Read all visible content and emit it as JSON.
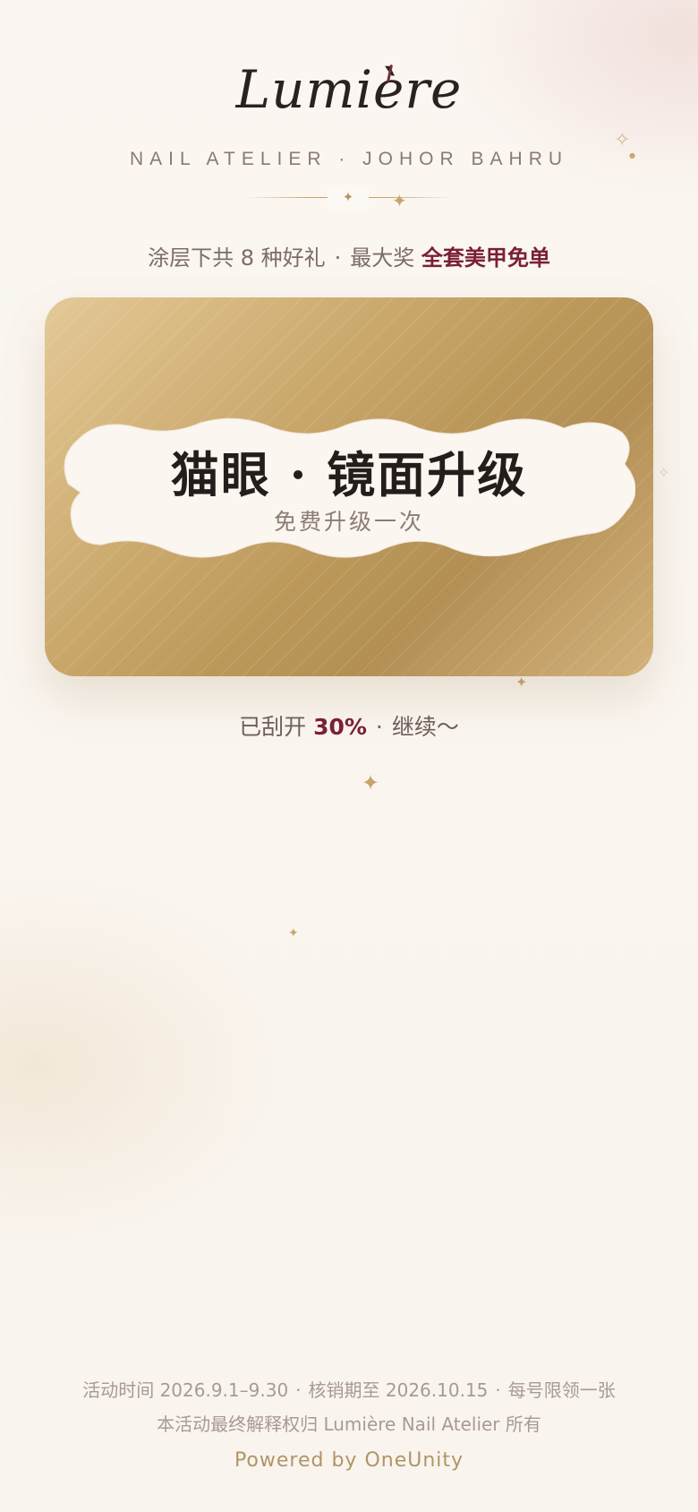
{
  "brand": {
    "logo": "Lumière",
    "subtitle": "NAIL ATELIER · JOHOR BAHRU"
  },
  "promo": {
    "prefix": "涂层下共 8 种好礼",
    "separator": "·",
    "label": "最大奖",
    "highlight": "全套美甲免单"
  },
  "card": {
    "prize_title": "猫眼 · 镜面升级",
    "prize_desc": "免费升级一次",
    "gradient_colors": [
      "#e4c997",
      "#cfae73",
      "#bb985a",
      "#b38f54",
      "#d2b27b"
    ]
  },
  "progress": {
    "label": "已刮开",
    "percent_text": "30%",
    "percent_value": 0.3,
    "separator": "·",
    "hint": "继续～"
  },
  "footer": {
    "period": "活动时间 2026.9.1–9.30",
    "redeem": "核销期至 2026.10.15",
    "limit": "每号限领一张",
    "separator": "·",
    "rights": "本活动最终解释权归 Lumière Nail Atelier 所有",
    "powered": "Powered by OneUnity"
  },
  "colors": {
    "accent": "#7a2035",
    "gold": "#c7a46b",
    "text": "#7d6c66"
  },
  "icons": [
    "sparkle-icon",
    "four-point-star-icon"
  ]
}
